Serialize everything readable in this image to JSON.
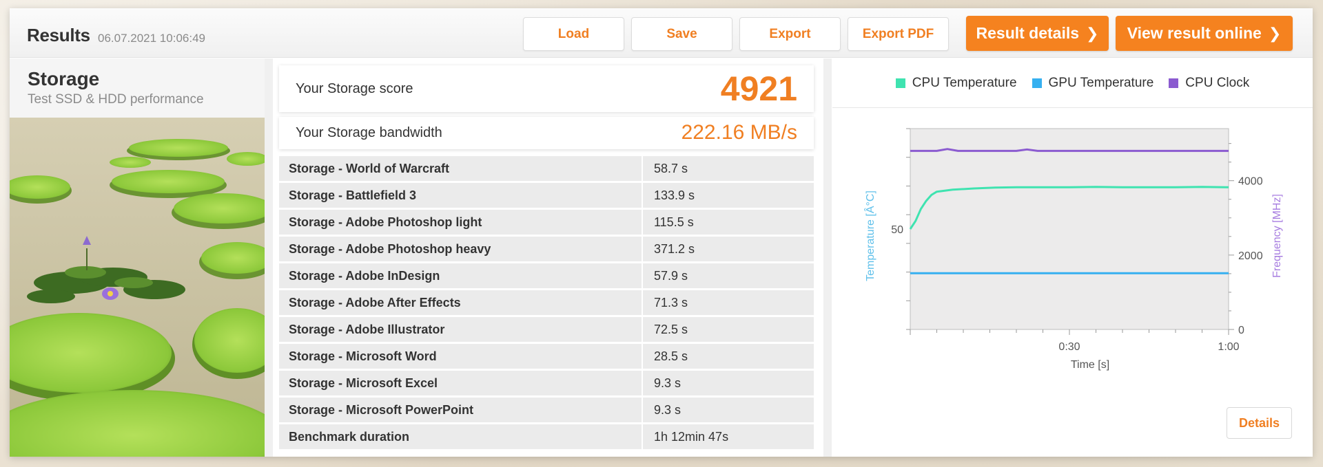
{
  "header": {
    "title": "Results",
    "timestamp": "06.07.2021 10:06:49",
    "buttons": {
      "load": "Load",
      "save": "Save",
      "export": "Export",
      "export_pdf": "Export PDF",
      "result_details": "Result details",
      "view_online": "View result online",
      "chevron": "❯"
    }
  },
  "test": {
    "title": "Storage",
    "subtitle": "Test SSD & HDD performance"
  },
  "score": {
    "label": "Your Storage score",
    "value": "4921"
  },
  "bandwidth": {
    "label": "Your Storage bandwidth",
    "value": "222.16 MB/s"
  },
  "results": [
    {
      "name": "Storage - World of Warcraft",
      "value": "58.7 s"
    },
    {
      "name": "Storage - Battlefield 3",
      "value": "133.9 s"
    },
    {
      "name": "Storage - Adobe Photoshop light",
      "value": "115.5 s"
    },
    {
      "name": "Storage - Adobe Photoshop heavy",
      "value": "371.2 s"
    },
    {
      "name": "Storage - Adobe InDesign",
      "value": "57.9 s"
    },
    {
      "name": "Storage - Adobe After Effects",
      "value": "71.3 s"
    },
    {
      "name": "Storage - Adobe Illustrator",
      "value": "72.5 s"
    },
    {
      "name": "Storage - Microsoft Word",
      "value": "28.5 s"
    },
    {
      "name": "Storage - Microsoft Excel",
      "value": "9.3 s"
    },
    {
      "name": "Storage - Microsoft PowerPoint",
      "value": "9.3 s"
    },
    {
      "name": "Benchmark duration",
      "value": "1h 12min 47s"
    }
  ],
  "details_button": "Details",
  "colors": {
    "accent": "#f5821f",
    "cpu_temp": "#3fe3b0",
    "gpu_temp": "#36b0f0",
    "cpu_clock": "#8b5bd0"
  },
  "chart_data": {
    "type": "line",
    "legend": [
      "CPU Temperature",
      "GPU Temperature",
      "CPU Clock"
    ],
    "legend_position": "top",
    "xlabel": "Time [s]",
    "ylabel_left": "Temperature [Â°C]",
    "ylabel_right": "Frequency [MHz]",
    "x_tick_labels": [
      "0:30",
      "1:00"
    ],
    "y_left_tick_labels": [
      "50"
    ],
    "y_right_tick_labels": [
      "0",
      "2000",
      "4000"
    ],
    "xlim": [
      0,
      60
    ],
    "ylim_left": [
      25,
      75
    ],
    "ylim_right": [
      0,
      5400
    ],
    "grid": false,
    "series": [
      {
        "name": "CPU Temperature",
        "axis": "left",
        "x": [
          0,
          1,
          2,
          3,
          4,
          5,
          8,
          12,
          16,
          20,
          25,
          30,
          35,
          40,
          45,
          50,
          55,
          60
        ],
        "values": [
          50,
          52,
          55,
          57,
          58.5,
          59.3,
          59.8,
          60.1,
          60.3,
          60.4,
          60.4,
          60.4,
          60.5,
          60.4,
          60.4,
          60.4,
          60.5,
          60.4
        ]
      },
      {
        "name": "GPU Temperature",
        "axis": "left",
        "x": [
          0,
          10,
          20,
          30,
          40,
          50,
          60
        ],
        "values": [
          39,
          39,
          39,
          39,
          39,
          39,
          39
        ]
      },
      {
        "name": "CPU Clock",
        "axis": "right",
        "x": [
          0,
          5,
          7,
          9,
          12,
          20,
          22,
          24,
          30,
          40,
          50,
          60
        ],
        "values": [
          4800,
          4800,
          4850,
          4800,
          4800,
          4800,
          4840,
          4800,
          4800,
          4800,
          4800,
          4800
        ]
      }
    ]
  }
}
